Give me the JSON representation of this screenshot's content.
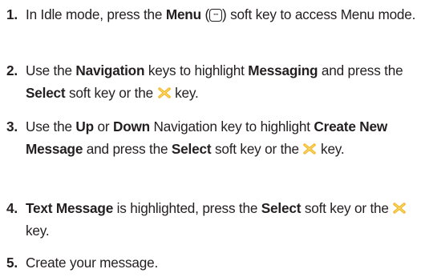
{
  "steps": [
    {
      "number": "1.",
      "t1": "In Idle mode, press the ",
      "b1": "Menu",
      "t2": " (",
      "t3": ") soft key to access Menu mode."
    },
    {
      "number": "2.",
      "t1": "Use the ",
      "b1": "Navigation",
      "t2": " keys to highlight ",
      "b2": "Messaging",
      "t3": " and press the ",
      "b3": "Select",
      "t4": " soft key or the ",
      "t5": " key."
    },
    {
      "number": "3.",
      "t1": "Use the ",
      "b1": "Up",
      "t2": " or ",
      "b2": "Down",
      "t3": " Navigation key to highlight ",
      "b3": "Create New Message",
      "t4": " and press the ",
      "b4": "Select",
      "t5": " soft key or the ",
      "t6": " key."
    },
    {
      "number": "4.",
      "b1": "Text Message",
      "t1": " is highlighted, press the ",
      "b2": "Select",
      "t2": " soft key or the ",
      "t3": " key."
    },
    {
      "number": "5.",
      "t1": "Create your message."
    }
  ],
  "icons": {
    "menu_key": "menu-soft-key-icon",
    "select_key": "select-key-icon"
  },
  "colors": {
    "text": "#231f20",
    "select_key": "#f2b418"
  }
}
